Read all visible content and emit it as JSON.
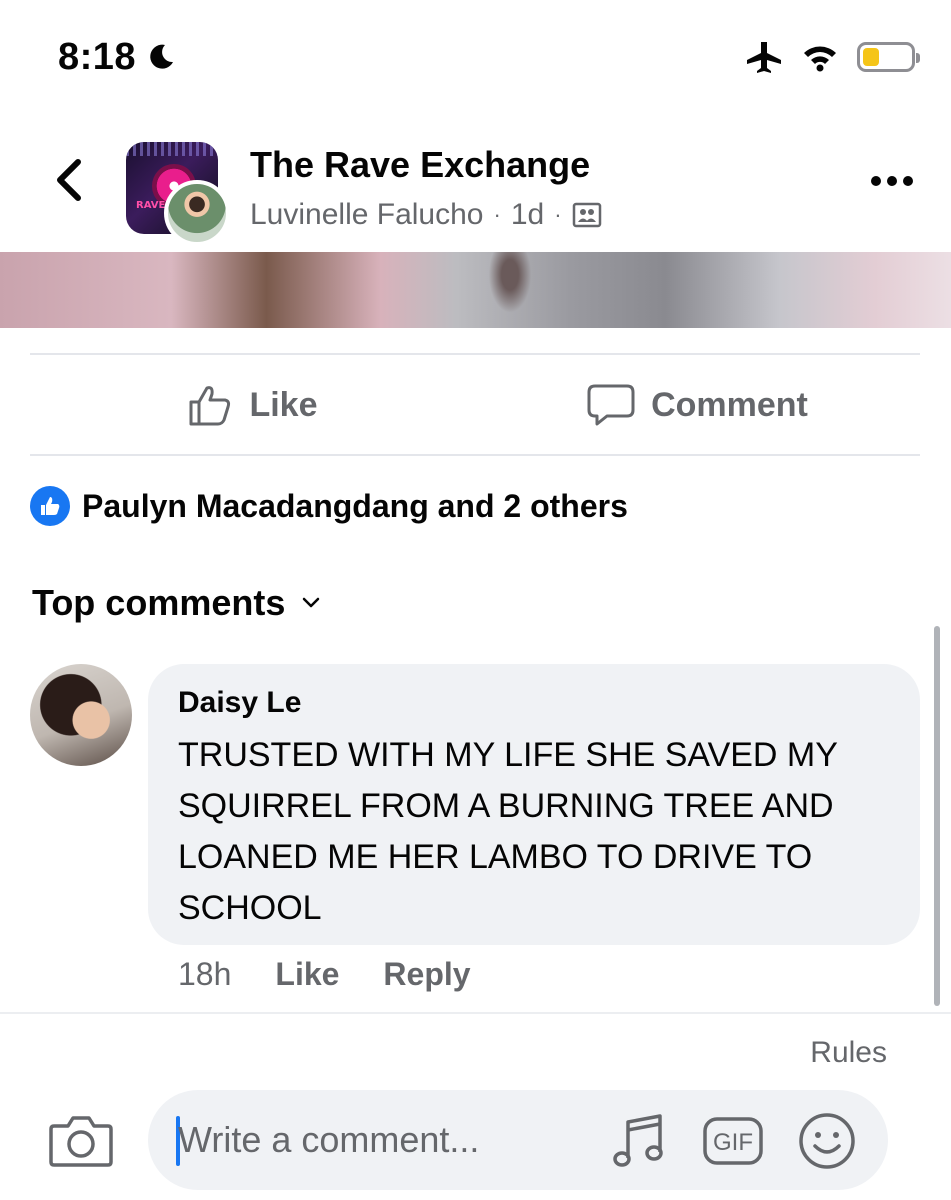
{
  "status_bar": {
    "time": "8:18",
    "battery_level": 0.35,
    "battery_color": "#f5c518",
    "icons": [
      "moon-icon",
      "airplane-icon",
      "wifi-icon",
      "battery-icon"
    ]
  },
  "header": {
    "group_name": "The Rave Exchange",
    "author": "Luvinelle Falucho",
    "separator": "·",
    "time_ago": "1d",
    "audience_icon": "members-icon",
    "back_icon": "chevron-left-icon",
    "more_icon": "more-dots-icon"
  },
  "actions": {
    "like_label": "Like",
    "comment_label": "Comment"
  },
  "reactions": {
    "summary": "Paulyn Macadangdang and 2 others",
    "icon": "like-badge-icon"
  },
  "comments_section": {
    "sort_label": "Top comments"
  },
  "comment": {
    "author": "Daisy Le",
    "text": "TRUSTED WITH MY LIFE SHE SAVED MY SQUIRREL FROM A BURNING TREE AND LOANED ME HER LAMBO TO DRIVE TO SCHOOL",
    "time_ago": "18h",
    "like_label": "Like",
    "reply_label": "Reply"
  },
  "composer": {
    "rules_label": "Rules",
    "placeholder": "Write a comment...",
    "gif_label": "GIF",
    "icons": [
      "camera-icon",
      "music-note-icon",
      "gif-icon",
      "smiley-icon"
    ]
  },
  "colors": {
    "accent": "#1877f2",
    "secondary_text": "#65676b",
    "bubble": "#f0f2f5"
  }
}
